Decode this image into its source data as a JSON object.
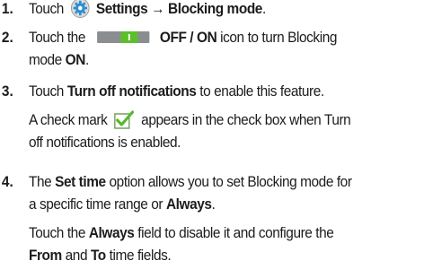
{
  "steps": [
    {
      "number": "1.",
      "lines": [
        {
          "text_before": "Touch",
          "settings_label": "Settings",
          "arrow": "→",
          "blocking_mode_label": "Blocking mode",
          "text_after": "."
        }
      ]
    },
    {
      "number": "2.",
      "lines": [
        {
          "text_before": "Touch the",
          "toggle_label": "OFF / ON",
          "text_after": "icon to turn Blocking"
        },
        {
          "text_before": "mode",
          "emphasis": "ON",
          "text_after": "."
        }
      ]
    },
    {
      "number": "3.",
      "lines": [
        {
          "text_before": "Touch",
          "emphasis": "Turn off notifications",
          "text_after": "to enable this feature."
        },
        {
          "text_before": "A check mark",
          "text_after": "appears in the check box when Turn"
        },
        {
          "text": "off notifications is enabled."
        }
      ]
    },
    {
      "number": "4.",
      "lines": [
        {
          "text_before": "The",
          "emphasis": "Set time",
          "text_after": "option allows you to set Blocking mode for"
        },
        {
          "text_before": "a specific time range or",
          "emphasis": "Always",
          "text_after": "."
        },
        {
          "text_before": "Touch the",
          "emphasis": "Always",
          "text_after": "field to disable it and configure the"
        },
        {
          "emphasis": "From",
          "text_mid": "and",
          "emphasis2": "To",
          "text_after": "time fields."
        }
      ]
    }
  ],
  "icons": {
    "settings": "gear-icon",
    "toggle": "toggle-switch-icon",
    "checkmark": "check-box-icon"
  },
  "colors": {
    "text": "#1c1c1c",
    "toggle_track": "#8a8e91",
    "toggle_thumb": "#5cbf2a",
    "check_green": "#55b82d",
    "gear_blue": "#2f8fd0"
  }
}
